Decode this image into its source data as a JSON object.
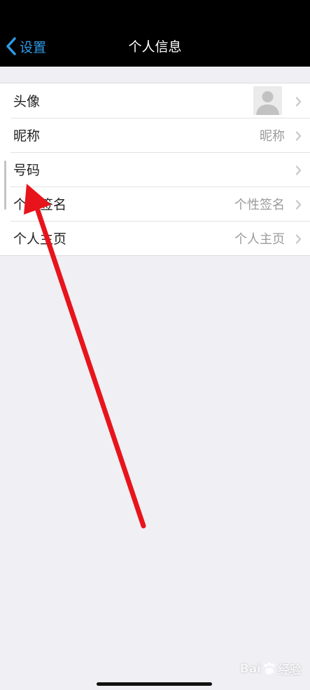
{
  "navbar": {
    "back_label": "设置",
    "title": "个人信息"
  },
  "rows": [
    {
      "label": "头像",
      "value": ""
    },
    {
      "label": "昵称",
      "value": "昵称"
    },
    {
      "label": "号码",
      "value": ""
    },
    {
      "label": "个性签名",
      "value": "个性签名"
    },
    {
      "label": "个人主页",
      "value": "个人主页"
    }
  ],
  "colors": {
    "accent": "#2f9be8",
    "navbar_bg": "#000000",
    "page_bg": "#efeff4",
    "annotation_arrow": "#e8141c"
  },
  "icons": {
    "back": "chevron-left-icon",
    "row_disclosure": "chevron-right-icon",
    "avatar": "default-avatar-icon"
  },
  "watermark": {
    "text_left": "Bai",
    "text_right": "经验"
  }
}
